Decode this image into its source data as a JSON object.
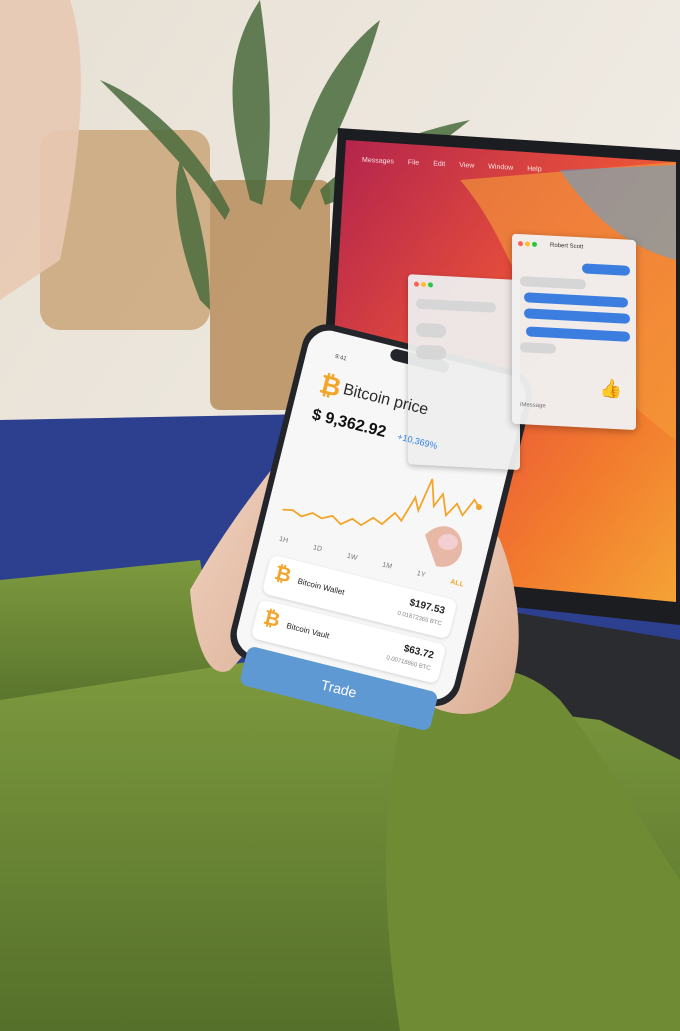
{
  "phone": {
    "time": "9:41",
    "app_title": "Bitcoin price",
    "price": "$ 9,362.92",
    "change": "+10,369%",
    "periods": [
      "1H",
      "1D",
      "1W",
      "1M",
      "1Y",
      "ALL"
    ],
    "wallets": [
      {
        "name": "Bitcoin Wallet",
        "amount": "$197.53",
        "sub": "0.01872365 BTC"
      },
      {
        "name": "Bitcoin Vault",
        "amount": "$63.72",
        "sub": "0.00718860 BTC"
      }
    ],
    "trade_label": "Trade",
    "logo_icon": "bitcoin-icon"
  },
  "laptop": {
    "menu": [
      "Messages",
      "File",
      "Edit",
      "View",
      "Window",
      "Help"
    ],
    "chat_title": "Robert Scott",
    "compose_placeholder": "iMessage",
    "reaction_icon": "thumbs-up-icon"
  },
  "colors": {
    "bitcoin_orange": "#f2a52b",
    "trade_blue": "#5f99d4",
    "accent_blue": "#2f7fe0",
    "sweater_green": "#6e8a3a",
    "table_blue": "#2d3f8f"
  }
}
